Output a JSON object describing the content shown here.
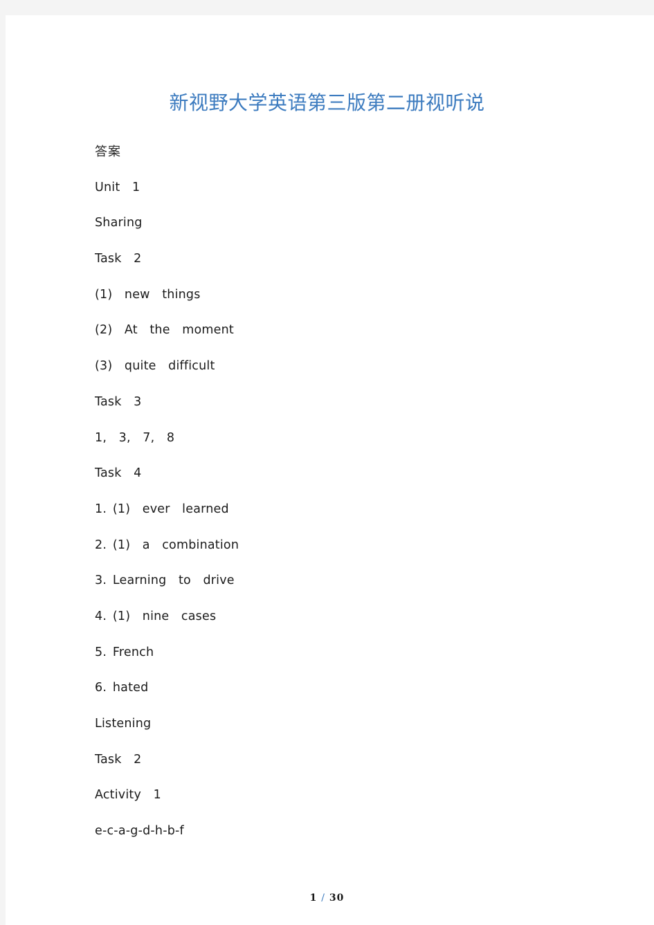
{
  "document": {
    "title": "新视野大学英语第三版第二册视听说",
    "title_color": "#3c7bbf",
    "page_background": "#ffffff",
    "gutter_color": "#f4f4f4",
    "lines": [
      {
        "text": "答案",
        "script": "cjk"
      },
      {
        "text": "Unit  1",
        "script": "latin"
      },
      {
        "text": "Sharing",
        "script": "latin"
      },
      {
        "text": "Task  2",
        "script": "latin"
      },
      {
        "text": "(1)  new  things",
        "script": "latin"
      },
      {
        "text": "(2)  At  the  moment",
        "script": "latin"
      },
      {
        "text": "(3)  quite  difficult",
        "script": "latin"
      },
      {
        "text": "Task  3",
        "script": "latin"
      },
      {
        "text": "1,  3,  7,  8",
        "script": "latin"
      },
      {
        "text": "Task  4",
        "script": "latin"
      },
      {
        "text": "1. (1)  ever  learned",
        "script": "latin"
      },
      {
        "text": "2. (1)  a  combination",
        "script": "latin"
      },
      {
        "text": "3. Learning  to  drive",
        "script": "latin"
      },
      {
        "text": "4. (1)  nine  cases",
        "script": "latin"
      },
      {
        "text": "5. French",
        "script": "latin"
      },
      {
        "text": "6. hated",
        "script": "latin"
      },
      {
        "text": "Listening",
        "script": "latin"
      },
      {
        "text": "Task  2",
        "script": "latin"
      },
      {
        "text": "Activity  1",
        "script": "latin"
      },
      {
        "text": "e-c-a-g-d-h-b-f",
        "script": "latin"
      }
    ]
  },
  "footer": {
    "current_page": "1",
    "separator": "/",
    "total_pages": "30"
  }
}
